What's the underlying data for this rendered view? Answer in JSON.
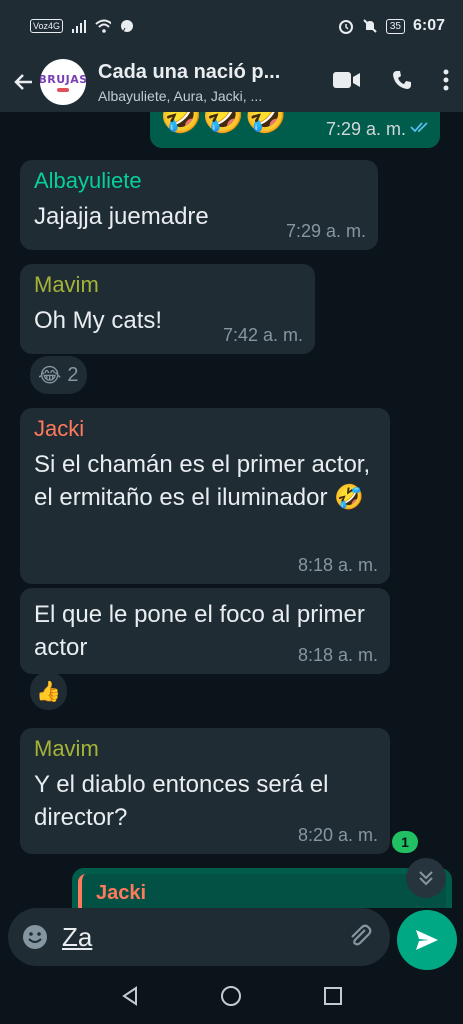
{
  "status": {
    "carrier": "Voz4G",
    "battery": "35",
    "time": "6:07"
  },
  "header": {
    "title": "Cada una nació p...",
    "subtitle": "Albayuliete, Aura, Jacki, ...",
    "avatar_text": "BRUJAS"
  },
  "messages": [
    {
      "sender": "",
      "text": "",
      "time": "7:29 a. m."
    },
    {
      "sender": "Albayuliete",
      "text": "Jajajja juemadre",
      "time": "7:29 a. m.",
      "sender_color": "#06cf9c"
    },
    {
      "sender": "Mavim",
      "text": "Oh My cats!",
      "time": "7:42 a. m.",
      "sender_color": "#a5b337",
      "reaction": "😂",
      "reaction_count": "2"
    },
    {
      "sender": "Jacki",
      "text": "Si el chamán es el primer actor, el ermitaño es el iluminador 🤣",
      "time": "8:18 a. m.",
      "sender_color": "#ff7a5c"
    },
    {
      "sender": "",
      "text": "El que le pone el foco al primer actor",
      "time": "8:18 a. m.",
      "reaction": "👍"
    },
    {
      "sender": "Mavim",
      "text": "Y el diablo entonces será el director?",
      "time": "8:20 a. m.",
      "sender_color": "#a5b337"
    }
  ],
  "outgoing_top": {
    "emojis": "🤣🤣🤣",
    "time": "7:29 a. m."
  },
  "reply_preview": {
    "name": "Jacki"
  },
  "unread_count": "1",
  "input": {
    "text": "Za"
  },
  "colors": {
    "bg": "#0b141a",
    "bubble_in": "#1f2c34",
    "bubble_out": "#005c4b",
    "accent": "#00a884"
  }
}
